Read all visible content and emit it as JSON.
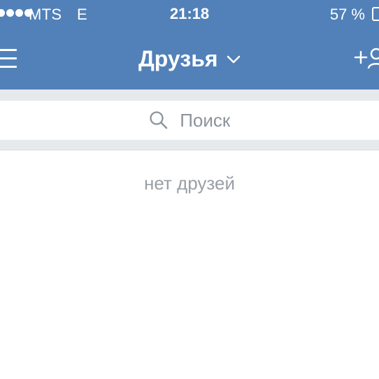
{
  "status_bar": {
    "carrier": "MTS",
    "network": "E",
    "time": "21:18",
    "battery": "57 %"
  },
  "nav": {
    "title": "Друзья"
  },
  "search": {
    "placeholder": "Поиск"
  },
  "content": {
    "empty_message": "нет друзей"
  },
  "colors": {
    "header_bg": "#5181b8",
    "separator_bg": "#e7eaed",
    "placeholder_text": "#8c939b",
    "empty_text": "#999fa5"
  },
  "icons": {
    "menu": "hamburger-menu-icon",
    "title_dropdown": "chevron-down-icon",
    "add_friend": "add-friend-icon",
    "search": "search-icon",
    "signal": "signal-dots-icon",
    "battery": "battery-icon"
  }
}
